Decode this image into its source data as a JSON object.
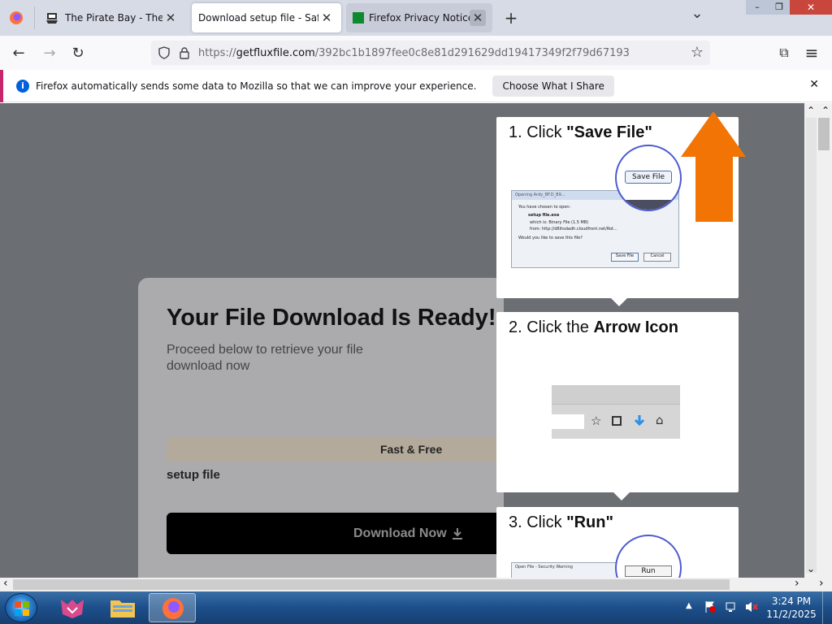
{
  "tabs": [
    {
      "title": "The Pirate Bay - The gal",
      "close": "✕"
    },
    {
      "title": "Download setup file - Safe &",
      "close": "✕"
    },
    {
      "title": "Firefox Privacy Notice —",
      "close": "✕"
    }
  ],
  "new_tab": "+",
  "tab_list": "⌄",
  "window": {
    "minimize": "–",
    "restore": "❐",
    "close": "✕"
  },
  "nav": {
    "back": "←",
    "forward": "→",
    "reload": "↻",
    "url_prefix": "https://",
    "url_host": "getfluxfile.com",
    "url_path": "/392bc1b1897fee0c8e81d291629dd19417349f2f79d67193",
    "bookmark": "☆",
    "extensions": "⧉",
    "menu": "≡"
  },
  "notification": {
    "text": "Firefox automatically sends some data to Mozilla so that we can improve your experience.",
    "button": "Choose What I Share",
    "close": "✕"
  },
  "card": {
    "title": "Your File Download Is Ready!",
    "subtitle_line1": "Proceed below to retrieve your file",
    "subtitle_line2": "download now",
    "badge": "Fast & Free",
    "file_name": "setup file",
    "download_button": "Download Now"
  },
  "steps": [
    {
      "num": "1. Click ",
      "bold": "\"Save File\"",
      "dialog": {
        "title": "Opening Ardy_BF.D_B9...",
        "line1": "You have chosen to open:",
        "file": "setup file.exe",
        "which": "which is: Binary File (1.5 MB)",
        "from": "from: http://d8ihsdadh.cloudfront.net/Rot...",
        "question": "Would you like to save this file?",
        "save": "Save File",
        "cancel": "Cancel"
      },
      "zoom_button": "Save File"
    },
    {
      "num": "2. Click the ",
      "bold": "Arrow Icon"
    },
    {
      "num": "3. Click ",
      "bold": "\"Run\"",
      "dialog_title": "Open File - Security Warning",
      "zoom_button": "Run"
    }
  ],
  "scroll": {
    "up": "⌃",
    "down": "⌄",
    "left": "‹",
    "right": "›"
  },
  "clock": {
    "time": "3:24 PM",
    "date": "11/2/2025"
  }
}
